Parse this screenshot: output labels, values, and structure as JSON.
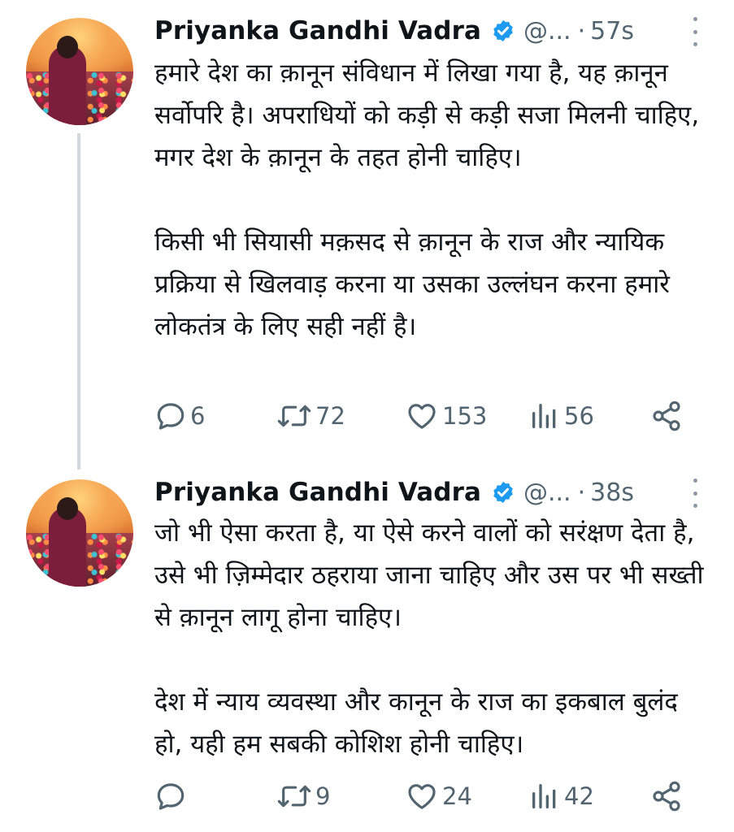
{
  "tweets": [
    {
      "author_name": "Priyanka Gandhi Vadra",
      "handle": "@...",
      "separator": "·",
      "time": "57s",
      "paragraphs": [
        "हमारे देश का क़ानून संविधान में लिखा गया है, यह क़ानून सर्वोपरि है। अपराधियों को कड़ी से कड़ी सजा मिलनी चाहिए, मगर देश के क़ानून के तहत होनी चाहिए।",
        "किसी भी सियासी मक़सद से क़ानून के राज और न्यायिक प्रक्रिया से खिलवाड़ करना या उसका उल्लंघन करना हमारे लोकतंत्र के लिए सही नहीं है।"
      ],
      "replies": "6",
      "retweets": "72",
      "likes": "153",
      "views": "56"
    },
    {
      "author_name": "Priyanka Gandhi Vadra",
      "handle": "@...",
      "separator": "·",
      "time": "38s",
      "paragraphs": [
        "जो भी ऐसा करता है, या ऐसे करने वालों को सरंक्षण देता है, उसे भी ज़िम्मेदार ठहराया जाना चाहिए और उस पर भी सख्ती से क़ानून लागू होना चाहिए।",
        "देश में न्याय व्यवस्था और कानून के राज का इकबाल बुलंद हो, यही हम सबकी कोशिश होनी चाहिए।"
      ],
      "replies": "",
      "retweets": "9",
      "likes": "24",
      "views": "42"
    }
  ],
  "icons": {
    "reply": "reply-icon",
    "retweet": "retweet-icon",
    "like": "heart-icon",
    "views": "views-icon",
    "share": "share-icon",
    "verified": "verified-badge-icon",
    "more": "more-options-icon"
  },
  "colors": {
    "text": "#0f1419",
    "muted": "#536471",
    "verified": "#1d9bf0",
    "thread_line": "#cfd9de"
  }
}
